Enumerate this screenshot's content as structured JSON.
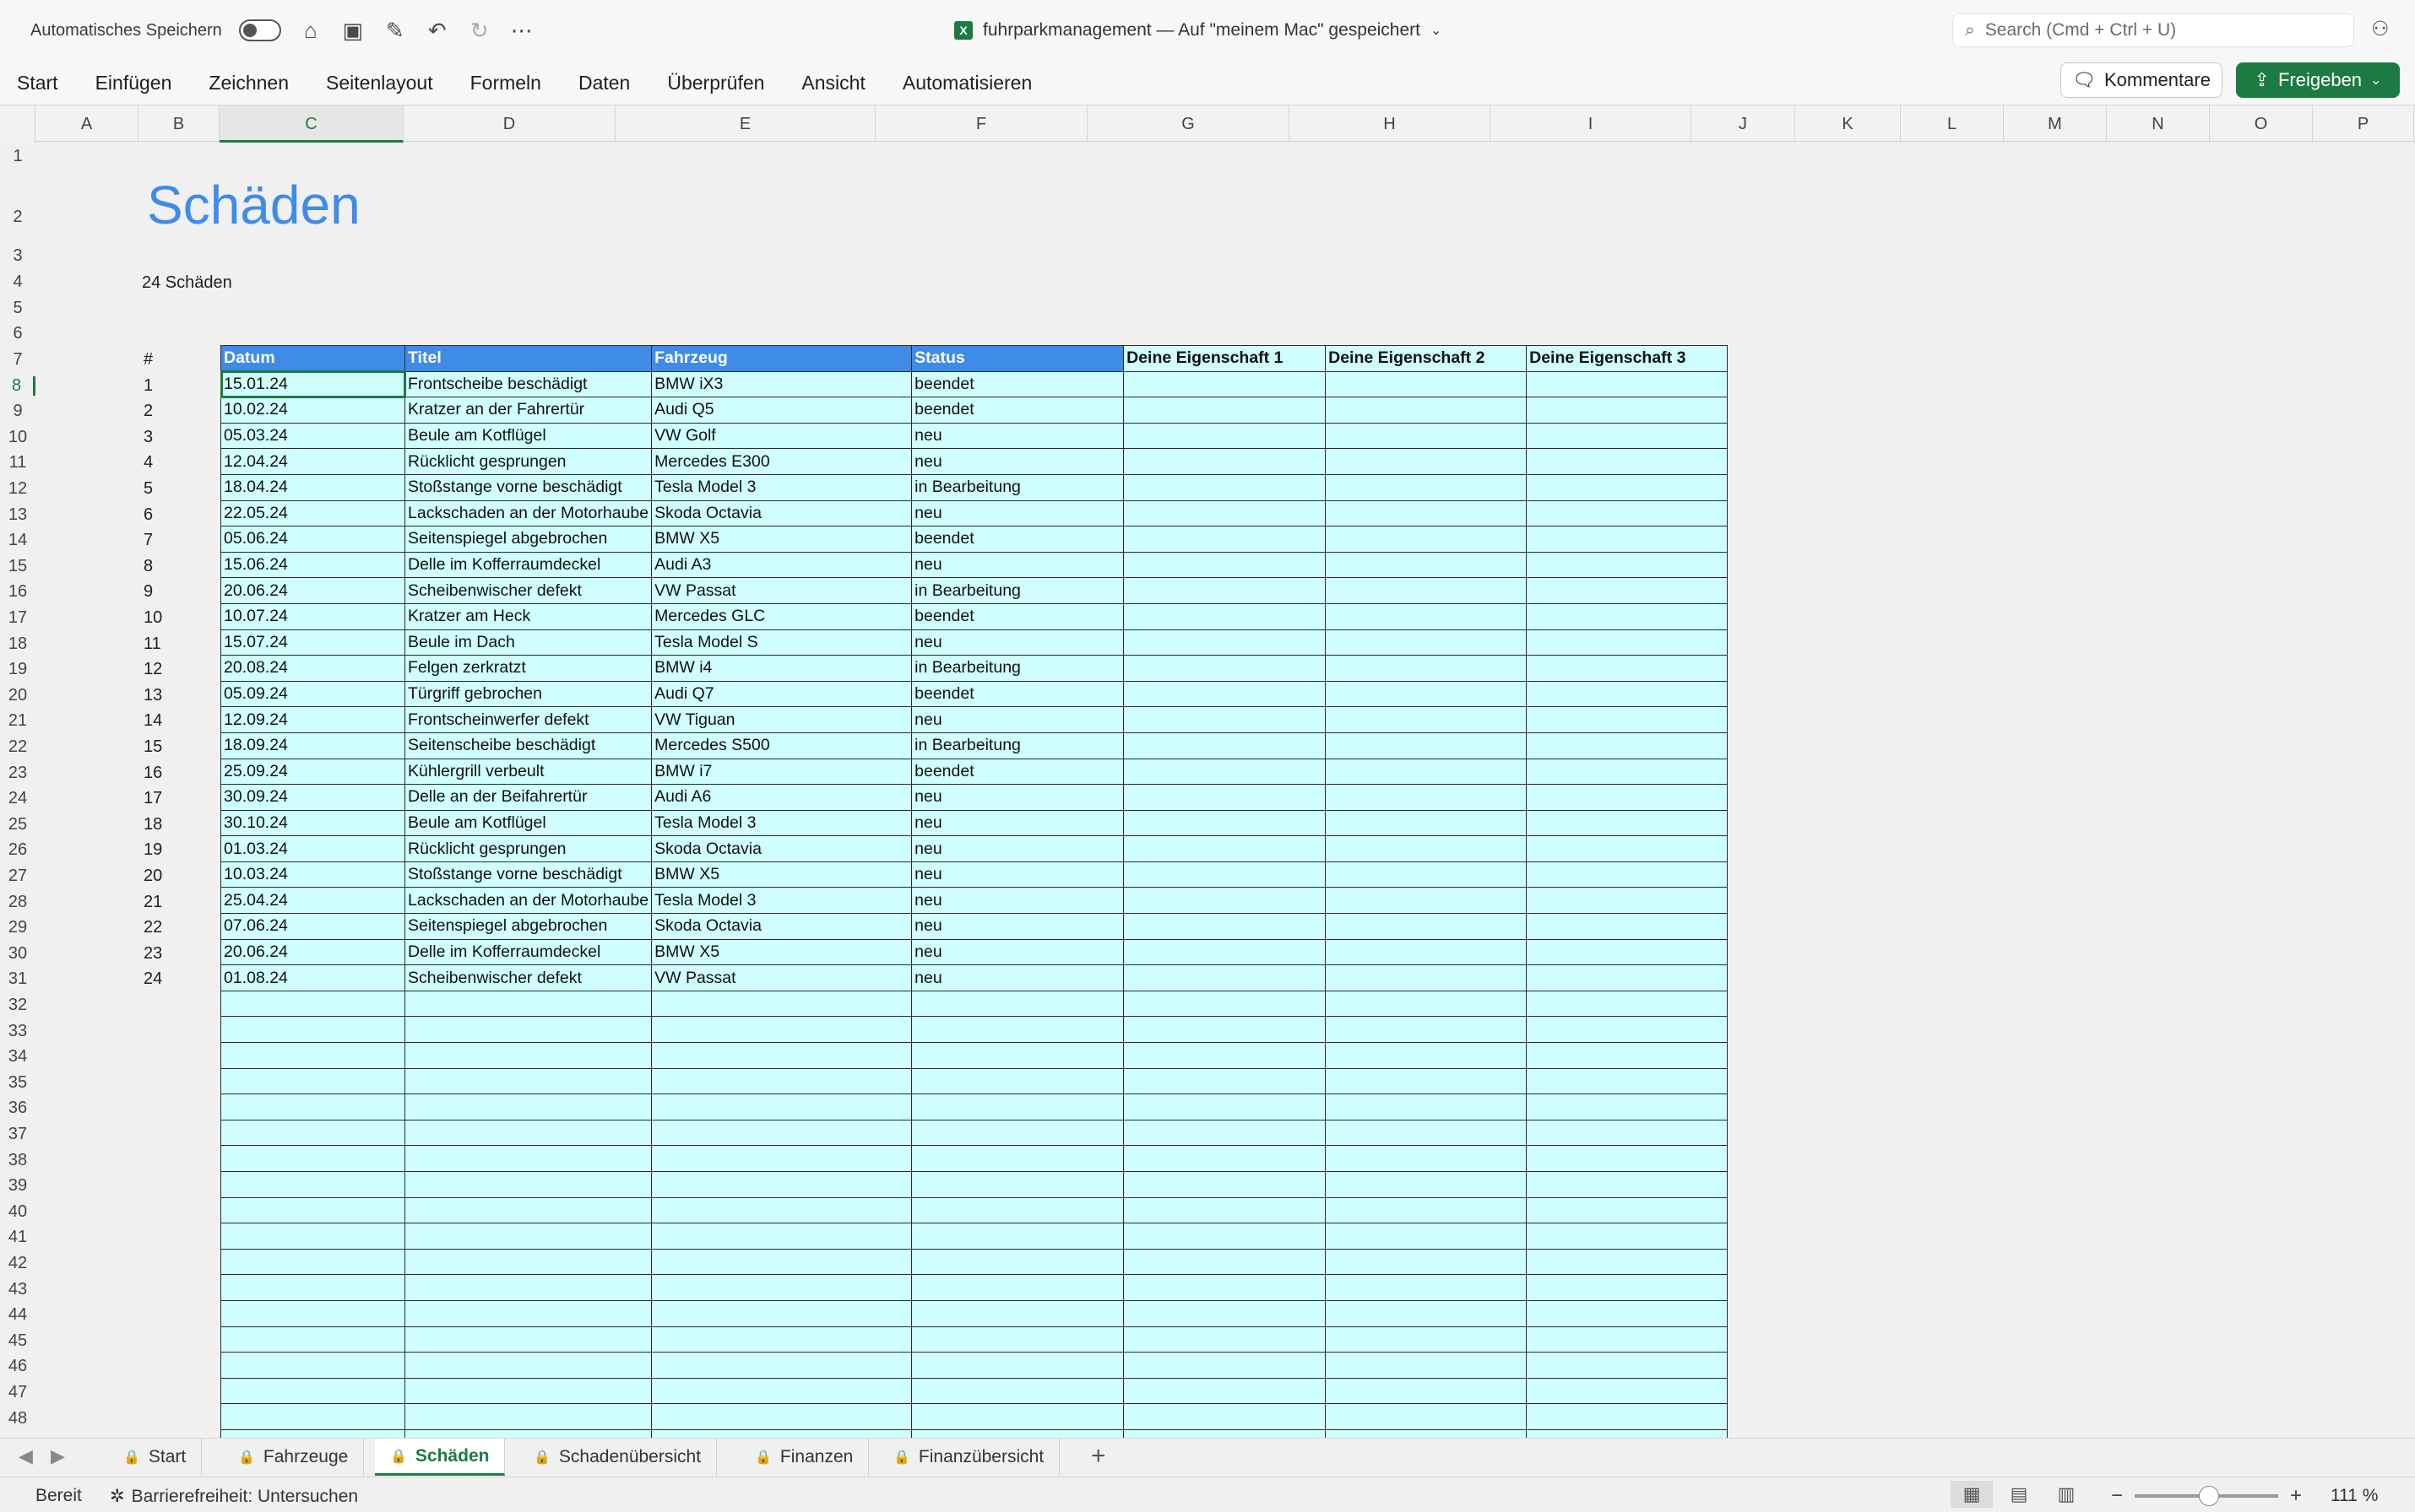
{
  "titlebar": {
    "autosave_label": "Automatisches Speichern",
    "doc_title": "fuhrparkmanagement — Auf \"meinem Mac\" gespeichert",
    "search_placeholder": "Search (Cmd + Ctrl + U)"
  },
  "ribbon": {
    "tabs": [
      "Start",
      "Einfügen",
      "Zeichnen",
      "Seitenlayout",
      "Formeln",
      "Daten",
      "Überprüfen",
      "Ansicht",
      "Automatisieren"
    ],
    "comments_label": "Kommentare",
    "share_label": "Freigeben"
  },
  "columns": [
    "A",
    "B",
    "C",
    "D",
    "E",
    "F",
    "G",
    "H",
    "I",
    "J",
    "K",
    "L",
    "M",
    "N",
    "O",
    "P"
  ],
  "active_column": "C",
  "active_row": 8,
  "row_numbers": [
    1,
    2,
    3,
    4,
    5,
    6,
    7,
    8,
    9,
    10,
    11,
    12,
    13,
    14,
    15,
    16,
    17,
    18,
    19,
    20,
    21,
    22,
    23,
    24,
    25,
    26,
    27,
    28,
    29,
    30,
    31,
    32,
    33,
    34,
    35,
    36,
    37,
    38,
    39,
    40,
    41,
    42,
    43,
    44,
    45,
    46,
    47,
    48
  ],
  "sheet": {
    "title": "Schäden",
    "count_label": "24 Schäden",
    "hash_label": "#",
    "headers": [
      "Datum",
      "Titel",
      "Fahrzeug",
      "Status",
      "Deine Eigenschaft 1",
      "Deine Eigenschaft 2",
      "Deine Eigenschaft 3"
    ],
    "rows": [
      {
        "n": "1",
        "datum": "15.01.24",
        "titel": "Frontscheibe beschädigt",
        "fahrzeug": "BMW iX3",
        "status": "beendet"
      },
      {
        "n": "2",
        "datum": "10.02.24",
        "titel": "Kratzer an der Fahrertür",
        "fahrzeug": "Audi Q5",
        "status": "beendet"
      },
      {
        "n": "3",
        "datum": "05.03.24",
        "titel": "Beule am Kotflügel",
        "fahrzeug": "VW Golf",
        "status": "neu"
      },
      {
        "n": "4",
        "datum": "12.04.24",
        "titel": "Rücklicht gesprungen",
        "fahrzeug": "Mercedes E300",
        "status": "neu"
      },
      {
        "n": "5",
        "datum": "18.04.24",
        "titel": "Stoßstange vorne beschädigt",
        "fahrzeug": "Tesla Model 3",
        "status": "in Bearbeitung"
      },
      {
        "n": "6",
        "datum": "22.05.24",
        "titel": "Lackschaden an der Motorhaube",
        "fahrzeug": "Skoda Octavia",
        "status": "neu"
      },
      {
        "n": "7",
        "datum": "05.06.24",
        "titel": "Seitenspiegel abgebrochen",
        "fahrzeug": "BMW X5",
        "status": "beendet"
      },
      {
        "n": "8",
        "datum": "15.06.24",
        "titel": "Delle im Kofferraumdeckel",
        "fahrzeug": "Audi A3",
        "status": "neu"
      },
      {
        "n": "9",
        "datum": "20.06.24",
        "titel": "Scheibenwischer defekt",
        "fahrzeug": "VW Passat",
        "status": "in Bearbeitung"
      },
      {
        "n": "10",
        "datum": "10.07.24",
        "titel": "Kratzer am Heck",
        "fahrzeug": "Mercedes GLC",
        "status": "beendet"
      },
      {
        "n": "11",
        "datum": "15.07.24",
        "titel": "Beule im Dach",
        "fahrzeug": "Tesla Model S",
        "status": "neu"
      },
      {
        "n": "12",
        "datum": "20.08.24",
        "titel": "Felgen zerkratzt",
        "fahrzeug": "BMW i4",
        "status": "in Bearbeitung"
      },
      {
        "n": "13",
        "datum": "05.09.24",
        "titel": "Türgriff gebrochen",
        "fahrzeug": "Audi Q7",
        "status": "beendet"
      },
      {
        "n": "14",
        "datum": "12.09.24",
        "titel": "Frontscheinwerfer defekt",
        "fahrzeug": "VW Tiguan",
        "status": "neu"
      },
      {
        "n": "15",
        "datum": "18.09.24",
        "titel": "Seitenscheibe beschädigt",
        "fahrzeug": "Mercedes S500",
        "status": "in Bearbeitung"
      },
      {
        "n": "16",
        "datum": "25.09.24",
        "titel": "Kühlergrill verbeult",
        "fahrzeug": "BMW i7",
        "status": "beendet"
      },
      {
        "n": "17",
        "datum": "30.09.24",
        "titel": "Delle an der Beifahrertür",
        "fahrzeug": "Audi A6",
        "status": "neu"
      },
      {
        "n": "18",
        "datum": "30.10.24",
        "titel": "Beule am Kotflügel",
        "fahrzeug": "Tesla Model 3",
        "status": "neu"
      },
      {
        "n": "19",
        "datum": "01.03.24",
        "titel": "Rücklicht gesprungen",
        "fahrzeug": "Skoda Octavia",
        "status": "neu"
      },
      {
        "n": "20",
        "datum": "10.03.24",
        "titel": "Stoßstange vorne beschädigt",
        "fahrzeug": "BMW X5",
        "status": "neu"
      },
      {
        "n": "21",
        "datum": "25.04.24",
        "titel": "Lackschaden an der Motorhaube",
        "fahrzeug": "Tesla Model 3",
        "status": "neu"
      },
      {
        "n": "22",
        "datum": "07.06.24",
        "titel": "Seitenspiegel abgebrochen",
        "fahrzeug": "Skoda Octavia",
        "status": "neu"
      },
      {
        "n": "23",
        "datum": "20.06.24",
        "titel": "Delle im Kofferraumdeckel",
        "fahrzeug": "BMW X5",
        "status": "neu"
      },
      {
        "n": "24",
        "datum": "01.08.24",
        "titel": "Scheibenwischer defekt",
        "fahrzeug": "VW Passat",
        "status": "neu"
      }
    ]
  },
  "sheet_tabs": [
    "Start",
    "Fahrzeuge",
    "Schäden",
    "Schadenübersicht",
    "Finanzen",
    "Finanzübersicht"
  ],
  "active_sheet_tab": "Schäden",
  "statusbar": {
    "ready": "Bereit",
    "accessibility": "Barrierefreiheit: Untersuchen",
    "zoom": "111 %"
  }
}
